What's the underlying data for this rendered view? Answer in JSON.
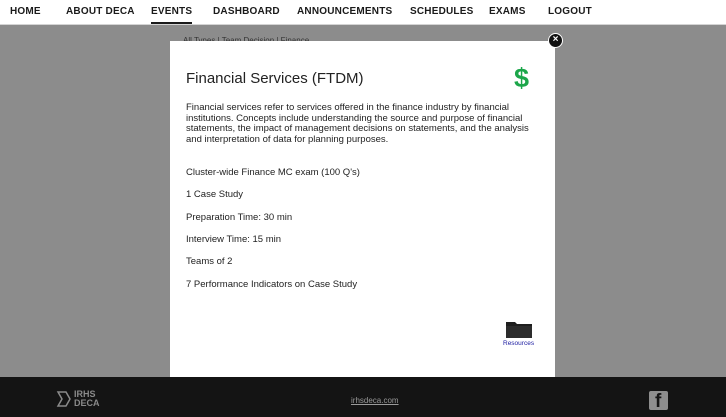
{
  "nav": {
    "items": [
      {
        "label": "HOME"
      },
      {
        "label": "ABOUT DECA"
      },
      {
        "label": "EVENTS"
      },
      {
        "label": "DASHBOARD"
      },
      {
        "label": "ANNOUNCEMENTS"
      },
      {
        "label": "SCHEDULES"
      },
      {
        "label": "EXAMS"
      },
      {
        "label": "LOGOUT"
      }
    ],
    "active": "EVENTS"
  },
  "breadcrumb": "All Types  |  Team Decision  |  Finance",
  "modal": {
    "title": "Financial Services (FTDM)",
    "icon": "dollar-icon",
    "description": "Financial services refer to services offered in the finance industry by financial institutions. Concepts include understanding the source and purpose of financial statements, the impact of management decisions on statements, and the analysis and interpretation of data for planning purposes.",
    "details": [
      "Cluster-wide Finance MC exam (100 Q's)",
      "1 Case Study",
      "Preparation Time: 30 min",
      "Interview Time: 15 min",
      "Teams of 2",
      "7 Performance Indicators on Case Study"
    ],
    "resources_label": "Resources",
    "close_icon": "close-icon"
  },
  "footer": {
    "logo_line1": "IRHS",
    "logo_line2": "DECA",
    "link": "irhsdeca.com",
    "social_icon": "facebook-icon"
  },
  "colors": {
    "accent_green": "#1ca64a",
    "overlay_gray": "#8f8f8f",
    "footer_bg": "#141414",
    "link_blue": "#1a1aa0"
  }
}
